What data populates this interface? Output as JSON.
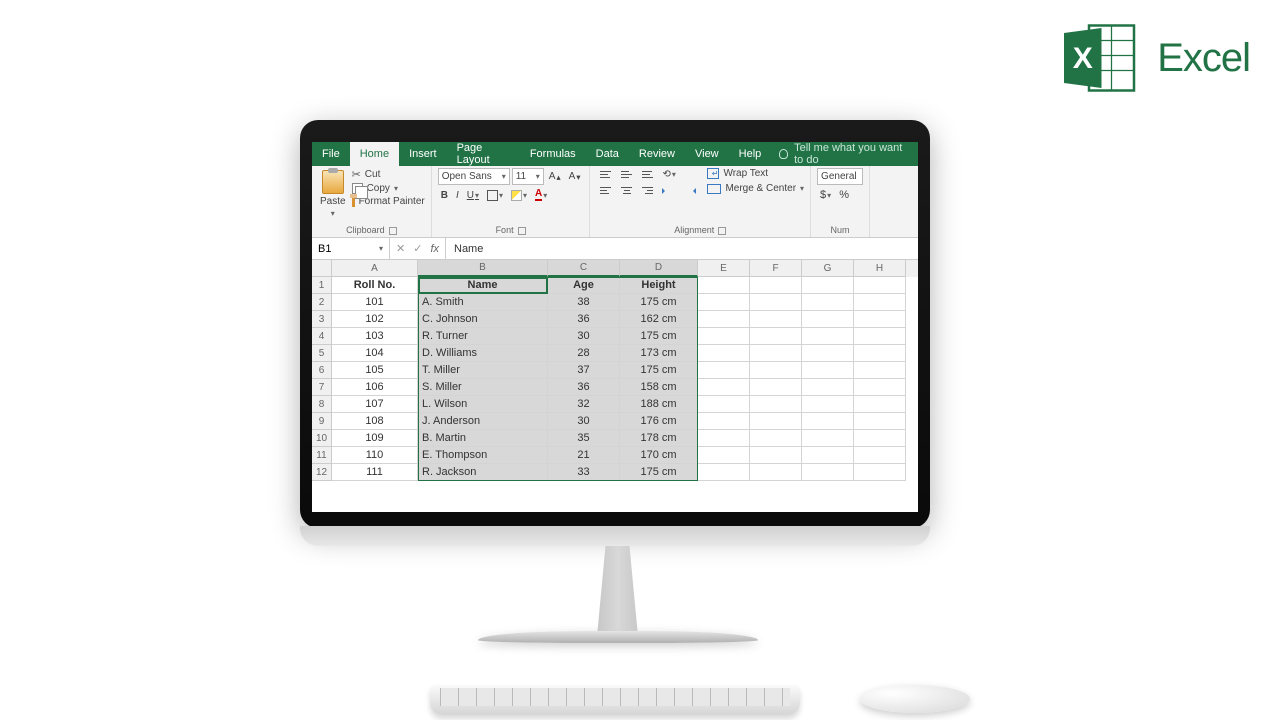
{
  "logo_text": "Excel",
  "tabs": {
    "file": "File",
    "home": "Home",
    "insert": "Insert",
    "page_layout": "Page Layout",
    "formulas": "Formulas",
    "data": "Data",
    "review": "Review",
    "view": "View",
    "help": "Help"
  },
  "tellme": "Tell me what you want to do",
  "clipboard": {
    "paste": "Paste",
    "cut": "Cut",
    "copy": "Copy",
    "format_painter": "Format Painter",
    "label": "Clipboard"
  },
  "font": {
    "name": "Open Sans",
    "size": "11",
    "label": "Font"
  },
  "alignment": {
    "wrap": "Wrap Text",
    "merge": "Merge & Center",
    "label": "Alignment"
  },
  "number": {
    "format": "General",
    "label": "Num"
  },
  "name_box": "B1",
  "formula_value": "Name",
  "columns": [
    "A",
    "B",
    "C",
    "D",
    "E",
    "F",
    "G",
    "H"
  ],
  "headers": {
    "a": "Roll No.",
    "b": "Name",
    "c": "Age",
    "d": "Height"
  },
  "rows": [
    {
      "n": 1
    },
    {
      "n": 2,
      "a": "101",
      "b": "A. Smith",
      "c": "38",
      "d": "175 cm"
    },
    {
      "n": 3,
      "a": "102",
      "b": "C. Johnson",
      "c": "36",
      "d": "162 cm"
    },
    {
      "n": 4,
      "a": "103",
      "b": "R. Turner",
      "c": "30",
      "d": "175 cm"
    },
    {
      "n": 5,
      "a": "104",
      "b": "D. Williams",
      "c": "28",
      "d": "173 cm"
    },
    {
      "n": 6,
      "a": "105",
      "b": "T. Miller",
      "c": "37",
      "d": "175 cm"
    },
    {
      "n": 7,
      "a": "106",
      "b": "S. Miller",
      "c": "36",
      "d": "158 cm"
    },
    {
      "n": 8,
      "a": "107",
      "b": "L. Wilson",
      "c": "32",
      "d": "188 cm"
    },
    {
      "n": 9,
      "a": "108",
      "b": "J. Anderson",
      "c": "30",
      "d": "176 cm"
    },
    {
      "n": 10,
      "a": "109",
      "b": "B. Martin",
      "c": "35",
      "d": "178 cm"
    },
    {
      "n": 11,
      "a": "110",
      "b": "E. Thompson",
      "c": "21",
      "d": "170 cm"
    },
    {
      "n": 12,
      "a": "111",
      "b": "R. Jackson",
      "c": "33",
      "d": "175 cm"
    }
  ]
}
